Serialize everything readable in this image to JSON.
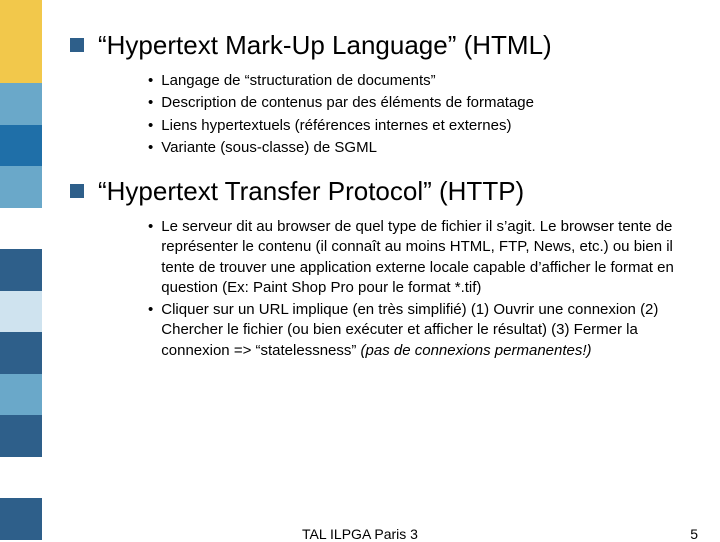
{
  "sidebar_colors": [
    "#f2c84b",
    "#f2c84b",
    "#6aa8c9",
    "#1f6fa8",
    "#6aa8c9",
    "#ffffff",
    "#2e5f8a",
    "#cfe3ef",
    "#2e5f8a",
    "#6aa8c9",
    "#2e5f8a",
    "#ffffff",
    "#2e5f8a"
  ],
  "sections": [
    {
      "title": "“Hypertext Mark-Up Language” (HTML)",
      "items": [
        "Langage de “structuration de documents”",
        "Description de contenus par des éléments de formatage",
        "Liens hypertextuels (références internes et externes)",
        "Variante (sous-classe) de SGML"
      ]
    },
    {
      "title": "“Hypertext Transfer Protocol” (HTTP)",
      "items": [
        "Le serveur dit au browser de quel type de fichier il s’agit. Le browser tente de représenter le contenu (il connaît au moins HTML, FTP, News, etc.) ou bien il tente de trouver une application externe locale capable d’afficher le format en question (Ex: Paint Shop Pro pour le format *.tif)",
        " Cliquer sur un URL implique (en très simplifié) (1) Ouvrir une connexion (2) Chercher le fichier (ou bien exécuter et afficher le résultat) (3) Fermer la connexion => “statelessness” <span class=\"italic\">(pas de connexions permanentes!)</span>"
      ]
    }
  ],
  "footer": {
    "center": "TAL ILPGA Paris 3",
    "right": "5"
  }
}
